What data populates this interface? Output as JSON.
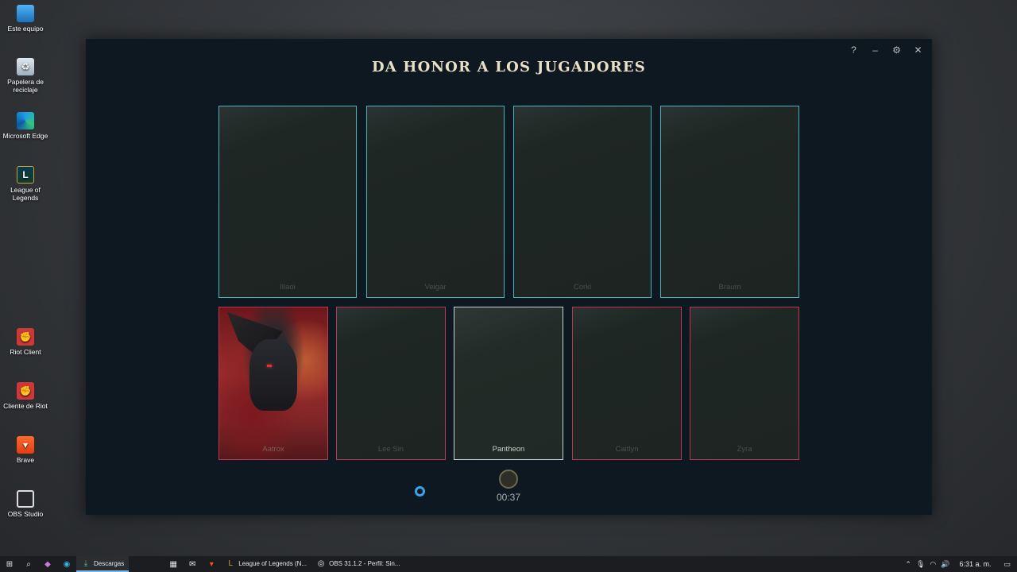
{
  "desktop": {
    "icons": [
      {
        "label": "Este equipo",
        "icon": "computer-icon"
      },
      {
        "label": "Papelera de reciclaje",
        "icon": "recycle-bin-icon"
      },
      {
        "label": "Microsoft Edge",
        "icon": "edge-icon"
      },
      {
        "label": "League of Legends",
        "icon": "league-of-legends-icon"
      },
      {
        "label": "Riot Client",
        "icon": "riot-client-icon"
      },
      {
        "label": "Cliente de Riot",
        "icon": "riot-client-icon"
      },
      {
        "label": "Brave",
        "icon": "brave-icon"
      },
      {
        "label": "OBS Studio",
        "icon": "obs-icon"
      }
    ]
  },
  "client": {
    "title": "DA HONOR A LOS JUGADORES",
    "controls": {
      "help": "?",
      "minimize": "–",
      "settings": "⚙",
      "close": "✕"
    },
    "allies": [
      "Illaoi",
      "Veigar",
      "Corki",
      "Braum"
    ],
    "enemies": [
      "Aatrox",
      "Lee Sin",
      "Pantheon",
      "Caitlyn",
      "Zyra"
    ],
    "selected": "Pantheon",
    "timer": "00:37"
  },
  "colors": {
    "ally_border": "#48b3bd",
    "enemy_border": "#b93751",
    "selected_border": "#c9d2d2",
    "title": "#e7dfc6"
  },
  "taskbar": {
    "apps": [
      {
        "label": "Descargas",
        "active": true
      },
      {
        "label": "League of Legends (N...",
        "active": false
      },
      {
        "label": "OBS 31.1.2 - Perfil: Sin...",
        "active": false
      }
    ],
    "clock": "6:31 a. m."
  }
}
